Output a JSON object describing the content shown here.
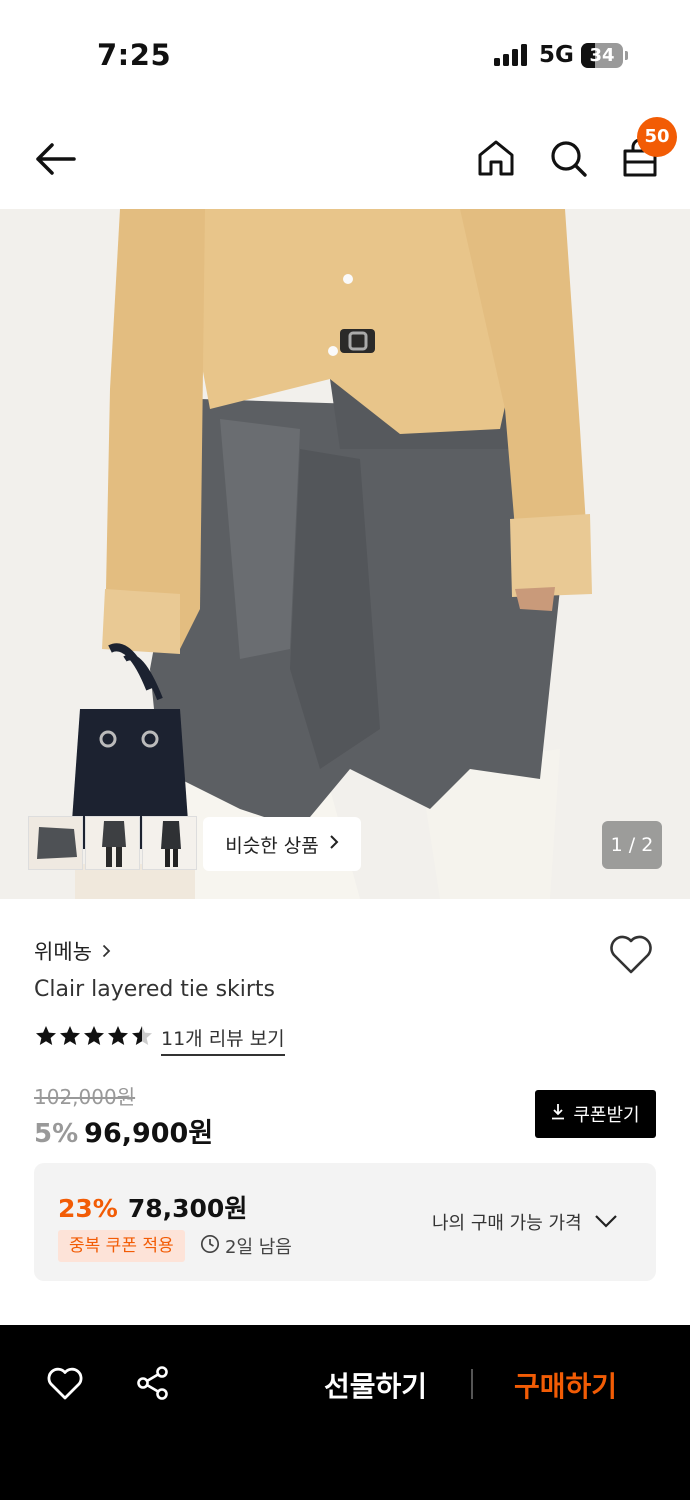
{
  "status_bar": {
    "time": "7:25",
    "network": "5G",
    "battery": "34",
    "battery_level": 0.34
  },
  "nav": {
    "cart_count": "50"
  },
  "product_image": {
    "similar_products_label": "비슷한 상품",
    "page_indicator": "1 / 2",
    "thumbnail_count": 3
  },
  "product": {
    "brand": "위메농",
    "name": "Clair layered tie skirts",
    "rating": 4.5,
    "review_link": "11개 리뷰 보기",
    "original_price": "102,000원",
    "discount_rate": "5%",
    "sale_price": "96,900원",
    "coupon_button": "쿠폰받기"
  },
  "benefit": {
    "rate": "23%",
    "price": "78,300원",
    "tag": "중복 쿠폰 적용",
    "time_left": "2일 남음",
    "toggle_label": "나의 구매 가능 가격"
  },
  "bottom_bar": {
    "gift_label": "선물하기",
    "buy_label": "구매하기"
  },
  "colors": {
    "accent": "#f25c05",
    "black": "#000000",
    "muted": "#999999"
  }
}
